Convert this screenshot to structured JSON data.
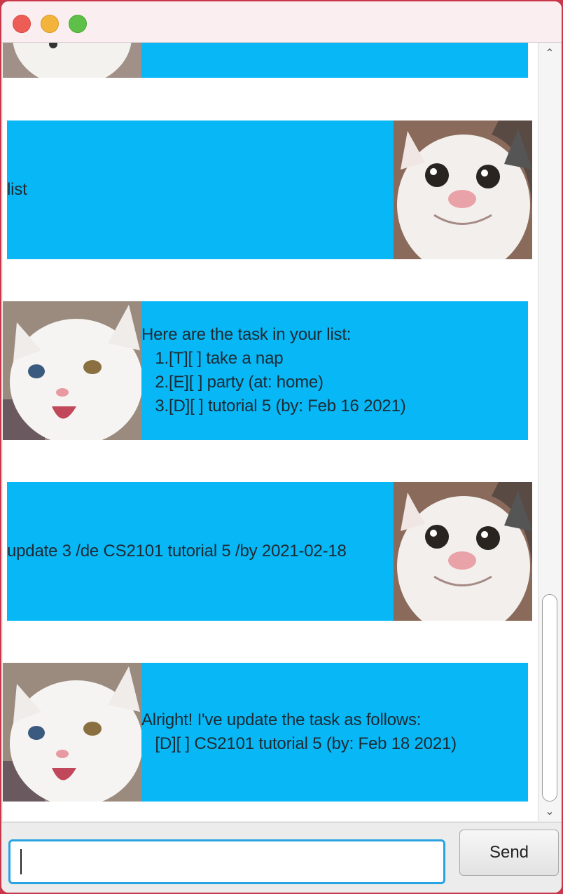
{
  "window": {
    "title": ""
  },
  "messages": [
    {
      "sender": "bot",
      "lines": [
        ""
      ],
      "avatar": "white-cat-icon"
    },
    {
      "sender": "user",
      "lines": [
        "list"
      ],
      "avatar": "smiling-cat-icon"
    },
    {
      "sender": "bot",
      "lines": [
        "Here are the task in your list:",
        "   1.[T][ ] take a nap",
        "   2.[E][ ] party (at: home)",
        "   3.[D][ ] tutorial 5 (by: Feb 16 2021)"
      ],
      "avatar": "white-cat-icon"
    },
    {
      "sender": "user",
      "lines": [
        "update 3 /de CS2101 tutorial 5 /by 2021-02-18"
      ],
      "avatar": "smiling-cat-icon"
    },
    {
      "sender": "bot",
      "lines": [
        "Alright! I've update the task as follows:",
        "   [D][ ] CS2101 tutorial 5 (by: Feb 18 2021)"
      ],
      "avatar": "white-cat-icon"
    }
  ],
  "colors": {
    "bubble": "#08b7f5",
    "background": "#ffffff"
  },
  "input": {
    "value": "",
    "placeholder": ""
  },
  "send_button": {
    "label": "Send"
  }
}
